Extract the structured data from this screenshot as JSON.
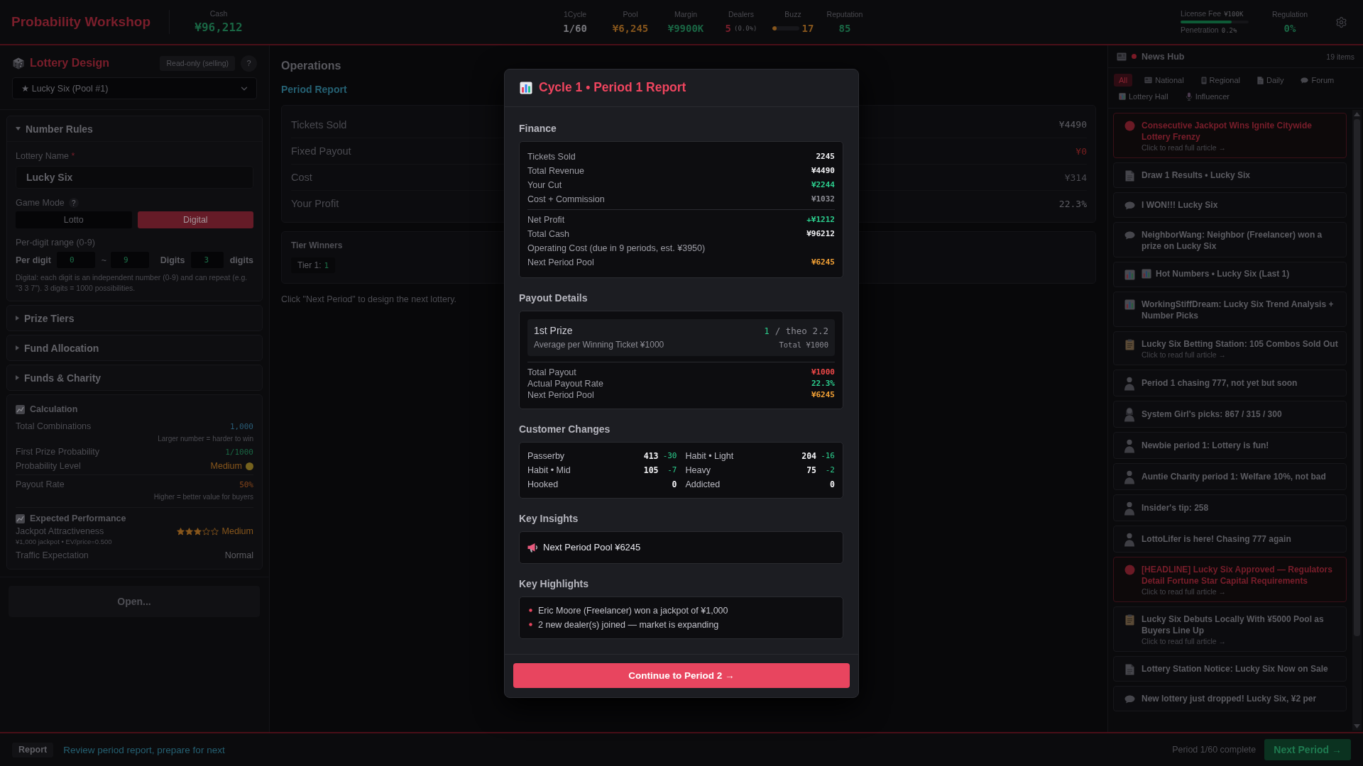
{
  "top_bar": {
    "title": "Probability Workshop",
    "cash": {
      "label": "Cash",
      "value": "¥96,212"
    },
    "stats": [
      {
        "kind": "value",
        "label": "1Cycle",
        "value": "1/60",
        "color": "#77777c"
      },
      {
        "kind": "value",
        "label": "Pool",
        "value": "¥6,245",
        "color": "#87561c"
      },
      {
        "kind": "value",
        "label": "Margin",
        "value": "¥9900K",
        "color": "#1a6644"
      },
      {
        "kind": "value",
        "label": "Dealers",
        "value": "5",
        "note": "(0.0%)",
        "color": "#7a1f2c"
      },
      {
        "kind": "meter",
        "label": "Buzz",
        "value": "17",
        "level": 0.17,
        "color": "#87561c"
      },
      {
        "kind": "value",
        "label": "Reputation",
        "value": "85",
        "color": "#1a6644"
      }
    ],
    "license": {
      "label": "License Fee",
      "value": "¥100K",
      "level": 0.75,
      "sub_label": "Penetration",
      "sub_value": "0.2%"
    },
    "regulation": {
      "label": "Regulation",
      "value": "0%"
    }
  },
  "lottery_design": {
    "title": "Lottery Design",
    "status": "Read-only (selling)",
    "help": "?",
    "selector": "★ Lucky Six (Pool #1)",
    "sections": [
      {
        "title": "Number Rules",
        "expanded": true,
        "fields": {
          "name_label": "Lottery Name",
          "required_mark": "*",
          "name_value": "Lucky Six",
          "mode_label": "Game Mode",
          "mode_help": "?",
          "modes": [
            {
              "label": "Lotto",
              "selected": false
            },
            {
              "label": "Digital",
              "selected": true
            }
          ],
          "range_label": "Per-digit range (0-9)",
          "per_digit_label": "Per digit",
          "range_min": "0",
          "range_sep": "~",
          "range_max": "9",
          "digits_label": "Digits",
          "digits_value": "3",
          "digits_unit": "digits",
          "note": "Digital: each digit is an independent number (0-9) and can repeat (e.g. \"3 3 7\"). 3 digits = 1000 possibilities."
        }
      },
      {
        "title": "Prize Tiers",
        "expanded": false
      },
      {
        "title": "Fund Allocation",
        "expanded": false
      },
      {
        "title": "Funds & Charity",
        "expanded": false
      }
    ],
    "calculation": {
      "title": "Calculation",
      "groups": [
        [
          {
            "kind": "number",
            "label": "Total Combinations",
            "value": "1,000",
            "color": "#2a5d78",
            "hint": "Larger number = harder to win"
          },
          {
            "kind": "number",
            "label": "First Prize Probability",
            "value": "1/1000",
            "color": "#1a6644"
          },
          {
            "kind": "level",
            "label": "Probability Level",
            "value": "Medium",
            "color": "#87561c",
            "dot": {
              "color": "#75621e"
            }
          }
        ],
        [
          {
            "kind": "number",
            "label": "Payout Rate",
            "value": "50%",
            "color": "#87461c",
            "hint": "Higher = better value for buyers"
          }
        ]
      ]
    },
    "performance": {
      "title": "Expected Performance",
      "rows": [
        {
          "label": "Jackpot Attractiveness",
          "stars": 3,
          "value": "Medium",
          "color": "#87561c",
          "sub": "¥1,000 jackpot • EV/price=0.500"
        },
        {
          "label": "Traffic Expectation",
          "value": "Normal",
          "color": "#5c5c61"
        }
      ]
    },
    "open_button": {
      "label": "Open...",
      "disabled": true
    }
  },
  "operations": {
    "title": "Operations",
    "report_title": "Period Report",
    "rows": [
      {
        "label": "Tickets Sold",
        "value": "¥4490",
        "color": "#5e5e64"
      },
      {
        "label": "Fixed Payout",
        "value": "¥0",
        "color": "#7a2020"
      },
      {
        "label": "Cost",
        "value": "¥314",
        "color": "#4a4a50"
      },
      {
        "label": "Your Profit",
        "value": "22.3%",
        "color": "#5e5e64"
      }
    ],
    "tier_winners": {
      "title": "Tier Winners",
      "tiers": [
        {
          "label": "Tier 1:",
          "count": "1"
        }
      ]
    },
    "note": "Click \"Next Period\" to design the next lottery."
  },
  "report_dialog": {
    "title": "Cycle 1 • Period 1 Report",
    "finance": {
      "title": "Finance",
      "groups": [
        [
          {
            "label": "Tickets Sold",
            "value": "2245",
            "color": "#f2f2f5"
          },
          {
            "label": "Total Revenue",
            "value": "¥4490",
            "color": "#f2f2f5"
          },
          {
            "label": "Your Cut",
            "value": "¥2244",
            "color": "#2ccf8e"
          },
          {
            "label": "Cost + Commission",
            "value": "¥1032",
            "color": "#8d8d95"
          }
        ],
        [
          {
            "label": "Net Profit",
            "value": "+¥1212",
            "color": "#2ccf8e"
          },
          {
            "label": "Total Cash",
            "value": "¥96212",
            "color": "#f2f2f5"
          },
          {
            "label": "Operating Cost (due in 9 periods, est. ¥3950)"
          },
          {
            "label": "Next Period Pool",
            "value": "¥6245",
            "color": "#f4a236"
          }
        ]
      ]
    },
    "payout": {
      "title": "Payout Details",
      "prizes": [
        {
          "name": "1st Prize",
          "count": "1",
          "theo": "/ theo 2.2",
          "average": "Average per Winning Ticket ¥1000",
          "total": "Total ¥1000"
        }
      ],
      "summary": [
        {
          "label": "Total Payout",
          "value": "¥1000",
          "color": "#f04848"
        },
        {
          "label": "Actual Payout Rate",
          "value": "22.3%",
          "color": "#2ccf8e"
        },
        {
          "label": "Next Period Pool",
          "value": "¥6245",
          "color": "#f4a236"
        }
      ]
    },
    "customers": {
      "title": "Customer Changes",
      "segments": [
        {
          "label": "Passerby",
          "count": "413",
          "delta": "-30"
        },
        {
          "label": "Habit • Light",
          "count": "204",
          "delta": "-16"
        },
        {
          "label": "Habit • Mid",
          "count": "105",
          "delta": "-7"
        },
        {
          "label": "Heavy",
          "count": "75",
          "delta": "-2"
        },
        {
          "label": "Hooked",
          "count": "0"
        },
        {
          "label": "Addicted",
          "count": "0"
        }
      ]
    },
    "insights": {
      "title": "Key Insights",
      "items": [
        "Next Period Pool ¥6245"
      ]
    },
    "highlights": {
      "title": "Key Highlights",
      "items": [
        "Eric Moore (Freelancer) won a jackpot of ¥1,000",
        "2 new dealer(s) joined — market is expanding"
      ]
    },
    "continue_button": "Continue to Period 2 →"
  },
  "news_hub": {
    "title": "News Hub",
    "live": true,
    "count": "19 items",
    "filters": [
      {
        "kind": "all",
        "label": "All",
        "selected": true
      },
      {
        "kind": "national",
        "label": "National",
        "selected": false
      },
      {
        "kind": "regional",
        "label": "Regional",
        "selected": false
      },
      {
        "kind": "daily",
        "label": "Daily",
        "selected": false
      },
      {
        "kind": "forum",
        "label": "Forum",
        "selected": false
      },
      {
        "kind": "hall",
        "label": "Lottery Hall",
        "selected": false
      },
      {
        "kind": "influencer",
        "label": "Influencer",
        "selected": false
      }
    ],
    "items": [
      {
        "kind": "breaking",
        "title": "Consecutive Jackpot Wins Ignite Citywide Lottery Frenzy",
        "link": "Click to read full article →"
      },
      {
        "kind": "document",
        "title": "Draw 1 Results • Lucky Six"
      },
      {
        "kind": "forum",
        "title": "I WON!!! Lucky Six"
      },
      {
        "kind": "forum",
        "title": "NeighborWang: Neighbor (Freelancer) won a prize on Lucky Six"
      },
      {
        "kind": "chart",
        "title": "Hot Numbers • Lucky Six (Last 1)",
        "title_icon": true
      },
      {
        "kind": "chart",
        "title": "WorkingStiffDream: Lucky Six Trend Analysis + Number Picks"
      },
      {
        "kind": "notice",
        "title": "Lucky Six Betting Station: 105 Combos Sold Out",
        "link": "Click to read full article →"
      },
      {
        "kind": "person",
        "title": "Period 1 chasing 777, not yet but soon"
      },
      {
        "kind": "person_long_hair",
        "title": "System Girl's picks: 867 / 315 / 300"
      },
      {
        "kind": "person",
        "title": "Newbie period 1: Lottery is fun!"
      },
      {
        "kind": "person",
        "title": "Auntie Charity period 1: Welfare 10%, not bad"
      },
      {
        "kind": "person",
        "title": "Insider's tip: 258"
      },
      {
        "kind": "person",
        "title": "LottoLifer is here! Chasing 777 again"
      },
      {
        "kind": "breaking",
        "title": "[HEADLINE] Lucky Six Approved — Regulators Detail Fortune Star Capital Requirements",
        "link": "Click to read full article →"
      },
      {
        "kind": "notice",
        "title": "Lucky Six Debuts Locally With ¥5000 Pool as Buyers Line Up",
        "link": "Click to read full article →"
      },
      {
        "kind": "document",
        "title": "Lottery Station Notice: Lucky Six Now on Sale"
      },
      {
        "kind": "forum",
        "title": "New lottery just dropped! Lucky Six, ¥2 per"
      }
    ]
  },
  "bottom_bar": {
    "mode": "Report",
    "hint": "Review period report, prepare for next",
    "progress": "Period 1/60 complete",
    "next_button": "Next Period →"
  }
}
